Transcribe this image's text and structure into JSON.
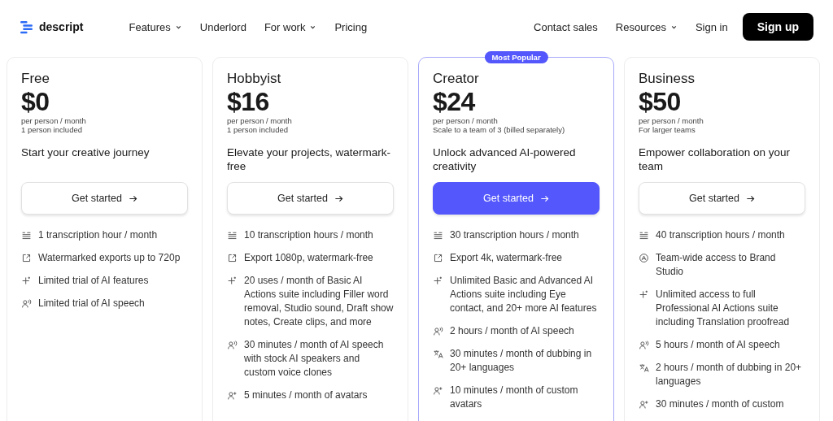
{
  "nav": {
    "logo": "descript",
    "links": [
      {
        "label": "Features",
        "dropdown": true
      },
      {
        "label": "Underlord",
        "dropdown": false
      },
      {
        "label": "For work",
        "dropdown": true
      },
      {
        "label": "Pricing",
        "dropdown": false
      }
    ],
    "right_links": [
      {
        "label": "Contact sales",
        "dropdown": false
      },
      {
        "label": "Resources",
        "dropdown": true
      },
      {
        "label": "Sign in",
        "dropdown": false
      }
    ],
    "signup": "Sign up"
  },
  "plans": [
    {
      "name": "Free",
      "price": "$0",
      "per": "per person / month",
      "seats": "1 person included",
      "tagline": "Start your creative journey",
      "button": "Get started",
      "featured": false,
      "features": [
        {
          "kind": "transcript",
          "text": "1 transcription hour / month"
        },
        {
          "kind": "export",
          "text": "Watermarked exports up to 720p"
        },
        {
          "kind": "sparkle",
          "text": "Limited trial of AI features"
        },
        {
          "kind": "speech",
          "text": "Limited trial of AI speech"
        }
      ]
    },
    {
      "name": "Hobbyist",
      "price": "$16",
      "per": "per person / month",
      "seats": "1 person included",
      "tagline": "Elevate your projects, watermark-free",
      "button": "Get started",
      "featured": false,
      "features": [
        {
          "kind": "transcript",
          "text": "10 transcription hours / month"
        },
        {
          "kind": "export",
          "text": "Export 1080p, watermark-free"
        },
        {
          "kind": "sparkle",
          "text": "20 uses / month of Basic AI Actions suite including Filler word removal, Studio sound, Draft show notes, Create clips, and more"
        },
        {
          "kind": "speech",
          "text": "30 minutes / month of AI speech with stock AI speakers and custom voice clones"
        },
        {
          "kind": "avatar",
          "text": "5 minutes / month of avatars"
        }
      ]
    },
    {
      "name": "Creator",
      "price": "$24",
      "per": "per person / month",
      "seats": "Scale to a team of 3 (billed separately)",
      "tagline": "Unlock advanced AI-powered creativity",
      "button": "Get started",
      "featured": true,
      "badge": "Most Popular",
      "features": [
        {
          "kind": "transcript",
          "text": "30 transcription hours / month"
        },
        {
          "kind": "export",
          "text": "Export 4k, watermark-free"
        },
        {
          "kind": "sparkle",
          "text": "Unlimited Basic and Advanced AI Actions suite including Eye contact, and 20+ more AI features"
        },
        {
          "kind": "speech",
          "text": "2 hours / month of AI speech"
        },
        {
          "kind": "dubbing",
          "text": "30 minutes / month of dubbing in 20+ languages"
        },
        {
          "kind": "avatar",
          "text": "10 minutes / month of custom avatars"
        }
      ]
    },
    {
      "name": "Business",
      "price": "$50",
      "per": "per person / month",
      "seats": "For larger teams",
      "tagline": "Empower collaboration on your team",
      "button": "Get started",
      "featured": false,
      "features": [
        {
          "kind": "transcript",
          "text": "40 transcription hours / month"
        },
        {
          "kind": "brand",
          "text": "Team-wide access to Brand Studio"
        },
        {
          "kind": "sparkle",
          "text": "Unlimited access to full Professional AI Actions suite including Translation proofread"
        },
        {
          "kind": "speech",
          "text": "5 hours / month of AI speech"
        },
        {
          "kind": "dubbing",
          "text": "2 hours / month of dubbing in 20+ languages"
        },
        {
          "kind": "avatar",
          "text": "30 minutes / month of custom"
        }
      ]
    }
  ]
}
